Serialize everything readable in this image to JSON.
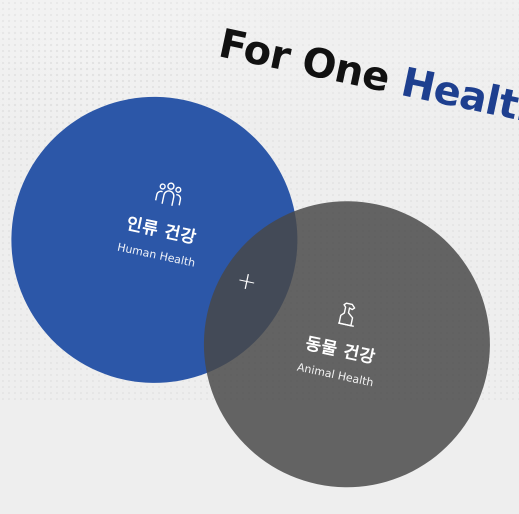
{
  "headline": {
    "prefix": "For One",
    "accent": "Health"
  },
  "circles": {
    "human": {
      "icon": "people-group-icon",
      "title_ko": "인류 건강",
      "title_en": "Human Health",
      "color": "#2c57a8"
    },
    "animal": {
      "icon": "dog-icon",
      "title_ko": "동물 건강",
      "title_en": "Animal Health",
      "color": "#4a4a4a"
    }
  },
  "connector": "+",
  "colors": {
    "accent": "#1e3f8f",
    "background": "#eeeeee"
  }
}
